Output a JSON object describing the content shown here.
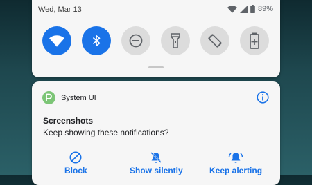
{
  "status_bar": {
    "date": "Wed, Mar 13",
    "battery": "89%",
    "icons": [
      "wifi-icon",
      "signal-icon",
      "battery-icon"
    ]
  },
  "quick_settings": {
    "tiles": [
      {
        "name": "wifi-icon",
        "state": "on"
      },
      {
        "name": "bluetooth-icon",
        "state": "on"
      },
      {
        "name": "do-not-disturb-icon",
        "state": "off"
      },
      {
        "name": "flashlight-icon",
        "state": "off"
      },
      {
        "name": "auto-rotate-icon",
        "state": "off"
      },
      {
        "name": "battery-saver-icon",
        "state": "off"
      }
    ],
    "accent": "#1a73e8",
    "tile_off_color": "#dcdcdc"
  },
  "notification": {
    "app_name": "System UI",
    "app_icon": "android-p-icon",
    "info_icon": "info-icon",
    "title": "Screenshots",
    "body": "Keep showing these notifications?",
    "actions": [
      {
        "label": "Block",
        "icon": "block-icon"
      },
      {
        "label": "Show silently",
        "icon": "bell-off-icon"
      },
      {
        "label": "Keep alerting",
        "icon": "bell-ring-icon"
      }
    ]
  }
}
